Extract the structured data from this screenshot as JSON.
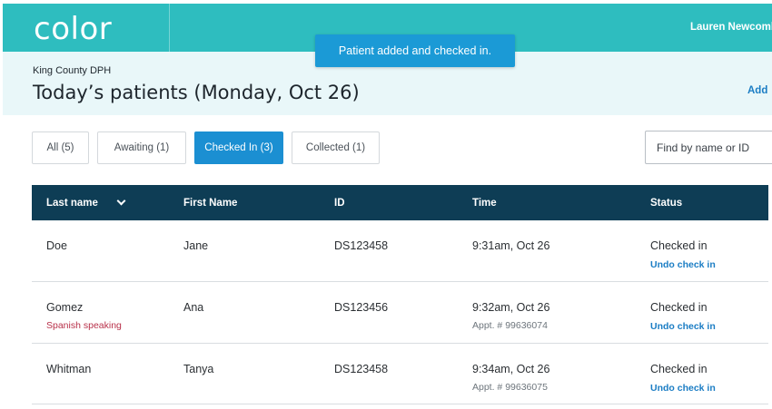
{
  "app": {
    "logo": "color",
    "user_name": "Lauren Newcomb"
  },
  "toast": {
    "message": "Patient added and checked in."
  },
  "header": {
    "org": "King County DPH",
    "title": "Today’s patients (Monday, Oct 26)",
    "add_label": "Add"
  },
  "tabs": [
    {
      "label": "All (5)",
      "active": false
    },
    {
      "label": "Awaiting (1)",
      "active": false
    },
    {
      "label": "Checked In (3)",
      "active": true
    },
    {
      "label": "Collected (1)",
      "active": false
    }
  ],
  "search": {
    "placeholder": "Find by name or ID"
  },
  "table": {
    "columns": [
      "Last name",
      "First Name",
      "ID",
      "Time",
      "Status"
    ],
    "undo_label": "Undo check in",
    "rows": [
      {
        "last": "Doe",
        "first": "Jane",
        "id": "DS123458",
        "time": "9:31am, Oct 26",
        "appt": "",
        "note": "",
        "status": "Checked in"
      },
      {
        "last": "Gomez",
        "first": "Ana",
        "id": "DS123456",
        "time": "9:32am, Oct 26",
        "appt": "Appt. # 99636074",
        "note": "Spanish speaking",
        "status": "Checked in"
      },
      {
        "last": "Whitman",
        "first": "Tanya",
        "id": "DS123458",
        "time": "9:34am, Oct 26",
        "appt": "Appt. # 99636075",
        "note": "",
        "status": "Checked in"
      }
    ]
  }
}
